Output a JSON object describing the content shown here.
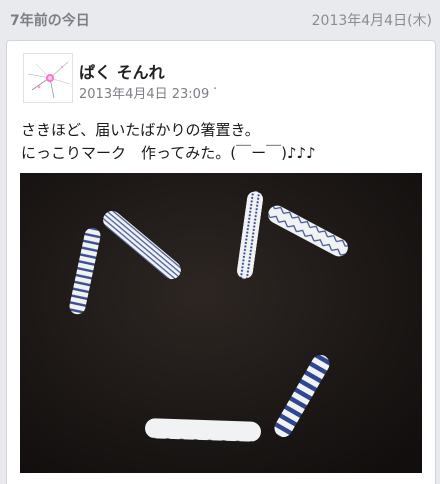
{
  "header": {
    "title": "7年前の今日",
    "date": "2013年4月4日(木)"
  },
  "post": {
    "author": "ぱく そんれ",
    "timestamp": "2013年4月4日 23:09",
    "more_glyph": "·",
    "text_lines": [
      "さきほど、届いたばかりの箸置き。",
      "にっこりマーク　作ってみた。(￣ー￣)♪♪♪"
    ]
  },
  "icons": {
    "avatar": "avatar-sparkle-icon"
  },
  "colors": {
    "background": "#e9eaee",
    "card": "#ffffff",
    "muted_text": "#7d7f86",
    "photo_bg": "#1c1715",
    "porcelain": "#f1f2f4",
    "pattern_blue": "#3a4f8f"
  }
}
